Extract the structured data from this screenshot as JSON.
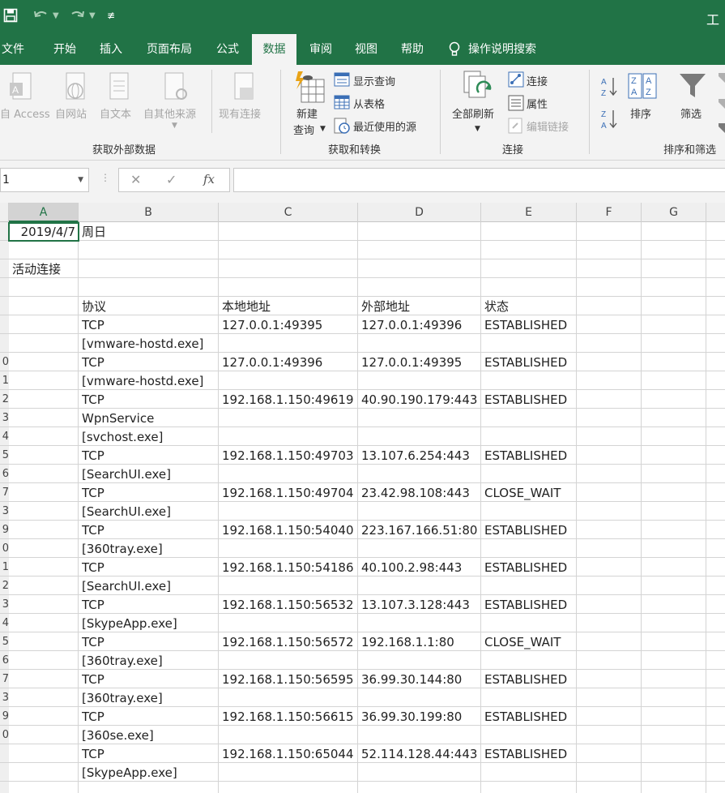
{
  "app": {
    "title_fragment": "工"
  },
  "colors": {
    "accent": "#217346",
    "ribbon_bg": "#f3f3f3",
    "selection": "#217346"
  },
  "quick_access": {
    "save_icon": "save-icon",
    "undo_icon": "undo-icon",
    "redo_icon": "redo-icon",
    "customize_icon": "customize-icon"
  },
  "tabs": [
    {
      "label": "文件"
    },
    {
      "label": "开始"
    },
    {
      "label": "插入"
    },
    {
      "label": "页面布局"
    },
    {
      "label": "公式"
    },
    {
      "label": "数据",
      "active": true
    },
    {
      "label": "审阅"
    },
    {
      "label": "视图"
    },
    {
      "label": "帮助"
    }
  ],
  "tellme": {
    "label": "操作说明搜索"
  },
  "ribbon": {
    "get_external": {
      "access": "自 Access",
      "web": "自网站",
      "text": "自文本",
      "other": "自其他来源",
      "existing": "现有连接",
      "group_label": "获取外部数据"
    },
    "get_transform": {
      "new_query_line1": "新建",
      "new_query_line2": "查询",
      "show_queries": "显示查询",
      "from_table": "从表格",
      "recent_sources": "最近使用的源",
      "group_label": "获取和转换"
    },
    "connections": {
      "refresh_all": "全部刷新",
      "connections": "连接",
      "properties": "属性",
      "edit_links": "编辑链接",
      "group_label": "连接"
    },
    "sort_filter": {
      "sort": "排序",
      "filter": "筛选",
      "group_label": "排序和筛选"
    }
  },
  "formula_bar": {
    "name_box": "1",
    "cancel": "✕",
    "enter": "✓",
    "fx": "fx",
    "formula": ""
  },
  "columns": [
    "A",
    "B",
    "C",
    "D",
    "E",
    "F",
    "G"
  ],
  "row_numbers": [
    "",
    "",
    "",
    "",
    "",
    "",
    "",
    "0",
    "1",
    "2",
    "3",
    "4",
    "5",
    "6",
    "7",
    "3",
    "9",
    "0",
    "1",
    "2",
    "3",
    "4",
    "5",
    "6",
    "7",
    "3",
    "9",
    "0"
  ],
  "rows": [
    {
      "A": "2019/4/7",
      "B": "周日"
    },
    {},
    {
      "A": "活动连接"
    },
    {},
    {
      "B": "协议",
      "C": "本地地址",
      "D": "外部地址",
      "E": "状态"
    },
    {
      "B": "TCP",
      "C": "127.0.0.1:49395",
      "D": "127.0.0.1:49396",
      "E": "ESTABLISHED"
    },
    {
      "B": "[vmware-hostd.exe]"
    },
    {
      "B": "TCP",
      "C": "127.0.0.1:49396",
      "D": "127.0.0.1:49395",
      "E": "ESTABLISHED"
    },
    {
      "B": "[vmware-hostd.exe]"
    },
    {
      "B": "TCP",
      "C": "192.168.1.150:49619",
      "D": "40.90.190.179:443",
      "E": "ESTABLISHED"
    },
    {
      "B": "WpnService"
    },
    {
      "B": "[svchost.exe]"
    },
    {
      "B": "TCP",
      "C": "192.168.1.150:49703",
      "D": "13.107.6.254:443",
      "E": "ESTABLISHED"
    },
    {
      "B": "[SearchUI.exe]"
    },
    {
      "B": "TCP",
      "C": "192.168.1.150:49704",
      "D": "23.42.98.108:443",
      "E": "CLOSE_WAIT"
    },
    {
      "B": "[SearchUI.exe]"
    },
    {
      "B": "TCP",
      "C": "192.168.1.150:54040",
      "D": "223.167.166.51:80",
      "E": "ESTABLISHED"
    },
    {
      "B": "[360tray.exe]"
    },
    {
      "B": "TCP",
      "C": "192.168.1.150:54186",
      "D": "40.100.2.98:443",
      "E": "ESTABLISHED"
    },
    {
      "B": "[SearchUI.exe]"
    },
    {
      "B": "TCP",
      "C": "192.168.1.150:56532",
      "D": "13.107.3.128:443",
      "E": "ESTABLISHED"
    },
    {
      "B": "[SkypeApp.exe]"
    },
    {
      "B": "TCP",
      "C": "192.168.1.150:56572",
      "D": "192.168.1.1:80",
      "E": "CLOSE_WAIT"
    },
    {
      "B": "[360tray.exe]"
    },
    {
      "B": "TCP",
      "C": "192.168.1.150:56595",
      "D": "36.99.30.144:80",
      "E": "ESTABLISHED"
    },
    {
      "B": "[360tray.exe]"
    },
    {
      "B": "TCP",
      "C": "192.168.1.150:56615",
      "D": "36.99.30.199:80",
      "E": "ESTABLISHED"
    },
    {
      "B": "[360se.exe]"
    },
    {
      "B": "TCP",
      "C": "192.168.1.150:65044",
      "D": "52.114.128.44:443",
      "E": "ESTABLISHED"
    },
    {
      "B": "[SkypeApp.exe]"
    }
  ]
}
